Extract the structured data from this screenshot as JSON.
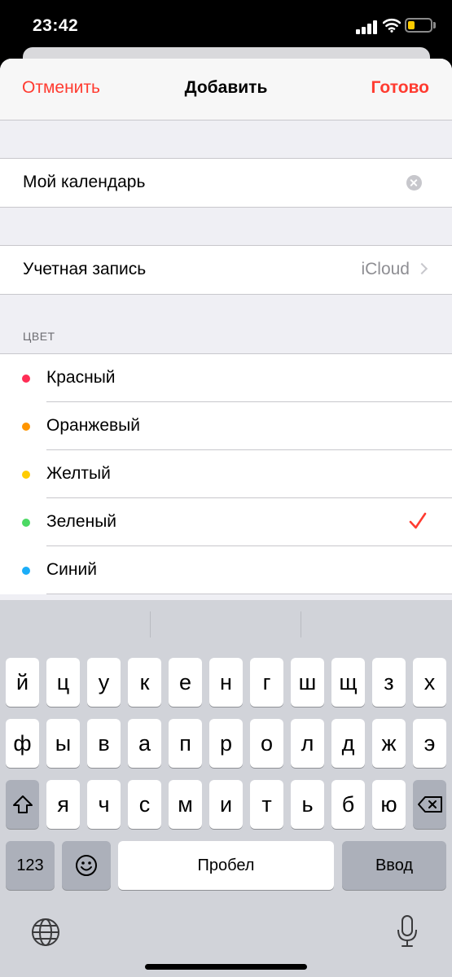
{
  "status": {
    "time": "23:42",
    "icons": [
      "signal-icon",
      "wifi-icon",
      "battery-icon"
    ],
    "battery_color": "#ffcc00"
  },
  "nav": {
    "cancel": "Отменить",
    "title": "Добавить",
    "done": "Готово",
    "accent": "#ff3b30"
  },
  "calendar": {
    "name_value": "Мой календарь",
    "clear_icon": "clear-icon"
  },
  "account": {
    "label": "Учетная запись",
    "value": "iCloud",
    "icon": "chevron-right-icon"
  },
  "color_section": {
    "header": "ЦВЕТ",
    "items": [
      {
        "label": "Красный",
        "color": "#ff2d55",
        "selected": false
      },
      {
        "label": "Оранжевый",
        "color": "#ff9500",
        "selected": false
      },
      {
        "label": "Желтый",
        "color": "#ffcc00",
        "selected": false
      },
      {
        "label": "Зеленый",
        "color": "#4cd964",
        "selected": true
      },
      {
        "label": "Синий",
        "color": "#1badf8",
        "selected": false
      }
    ],
    "check_icon": "checkmark-icon"
  },
  "keyboard": {
    "row1": [
      "й",
      "ц",
      "у",
      "к",
      "е",
      "н",
      "г",
      "ш",
      "щ",
      "з",
      "х"
    ],
    "row2": [
      "ф",
      "ы",
      "в",
      "а",
      "п",
      "р",
      "о",
      "л",
      "д",
      "ж",
      "э"
    ],
    "row3": [
      "я",
      "ч",
      "с",
      "м",
      "и",
      "т",
      "ь",
      "б",
      "ю"
    ],
    "shift_icon": "shift-icon",
    "delete_icon": "backspace-icon",
    "numbers": "123",
    "emoji_icon": "emoji-icon",
    "space": "Пробел",
    "return": "Ввод",
    "globe_icon": "globe-icon",
    "mic_icon": "microphone-icon"
  }
}
